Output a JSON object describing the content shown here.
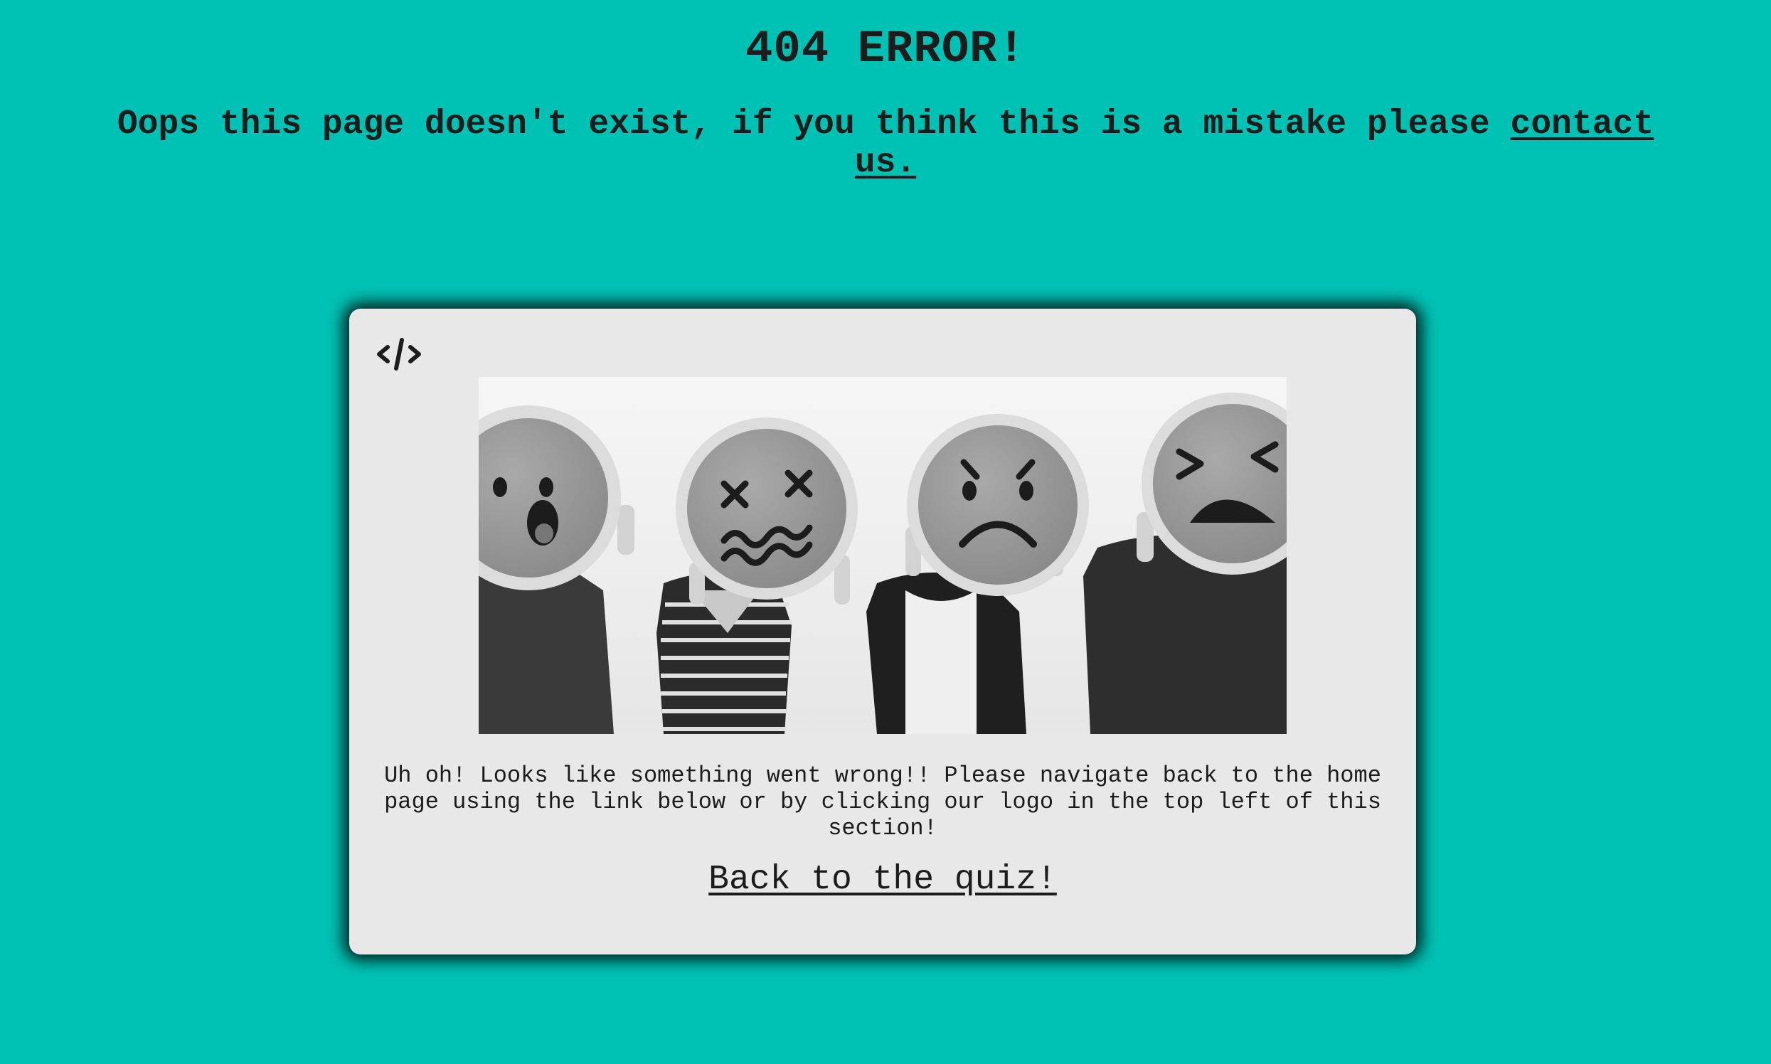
{
  "header": {
    "title": "404 ERROR!",
    "subtitle_text": "Oops this page doesn't exist, if you think this is a mistake please ",
    "contact_link": "contact us."
  },
  "card": {
    "logo_icon": "code-brackets-icon",
    "image_icon": "emoji-faces-photo",
    "message": "Uh oh! Looks like something went wrong!! Please navigate back to the home page using the link below or by clicking our logo in the top left of this section!",
    "back_link": "Back to the quiz!"
  },
  "colors": {
    "background": "#00c2b4",
    "card": "#e8e8e8",
    "text": "#1c1c1c"
  }
}
